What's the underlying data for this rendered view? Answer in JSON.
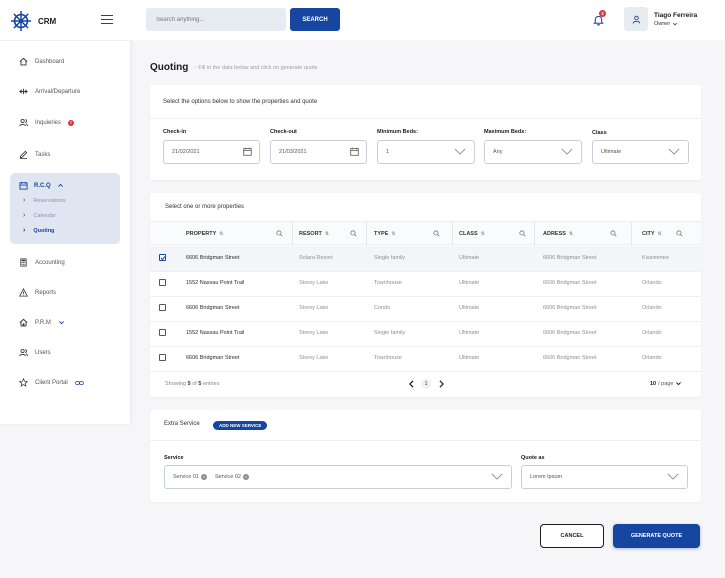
{
  "app": {
    "name": "CRM"
  },
  "colors": {
    "primary": "#1646a0",
    "alert": "#e2303a",
    "selected_bg": "#dfe6f1"
  },
  "sidebar": {
    "items": [
      {
        "label": "Dashboard",
        "icon": "home-icon"
      },
      {
        "label": "Arrival/Departure",
        "icon": "arrows-icon"
      },
      {
        "label": "Inquieries",
        "icon": "users-icon",
        "badge": "!"
      },
      {
        "label": "Tasks",
        "icon": "pencil-icon"
      },
      {
        "label": "R.C.Q",
        "icon": "calendar-icon"
      },
      {
        "label": "Accounting",
        "icon": "calculator-icon"
      },
      {
        "label": "Reports",
        "icon": "warning-icon"
      },
      {
        "label": "P.R.M",
        "icon": "home-icon"
      },
      {
        "label": "Users",
        "icon": "users-icon"
      },
      {
        "label": "Client Portal",
        "icon": "star-icon"
      }
    ],
    "rcq_sub": [
      "Reservations",
      "Calendar",
      "Quoting"
    ]
  },
  "header": {
    "search_placeholder": "Search anything...",
    "search_label": "SEARCH",
    "notifications": "2",
    "user_name": "Tiago Ferreira",
    "user_role": "Owner"
  },
  "page": {
    "title": "Quoting",
    "subtitle": "- Fill in the data below and click on generate quote"
  },
  "filters": {
    "title": "Select the options below to show the properties and quote",
    "checkin_label": "Check-in",
    "checkin_value": "21/02/2021",
    "checkout_label": "Check-out",
    "checkout_value": "21/03/2021",
    "minbeds_label": "Minimum Beds:",
    "minbeds_value": "1",
    "maxbeds_label": "Maximum Beds:",
    "maxbeds_value": "Any",
    "class_label": "Class",
    "class_value": "Ultimate"
  },
  "properties": {
    "title": "Select one or more properties",
    "headers": [
      "PROPERTY",
      "RESORT",
      "TYPE",
      "CLASS",
      "ADRESS",
      "CITY"
    ],
    "rows": [
      {
        "checked": true,
        "property": "6606 Bridgman Street",
        "resort": "Solara Resort",
        "type": "Single family",
        "class": "Ultimate",
        "address": "6606 Bridgman Street",
        "city": "Kissimmee"
      },
      {
        "checked": false,
        "property": "1552 Nassau Point Trail",
        "resort": "Storey Lake",
        "type": "Townhouse",
        "class": "Ultimate",
        "address": "6606 Bridgman Street",
        "city": "Orlando"
      },
      {
        "checked": false,
        "property": "6606 Bridgman Street",
        "resort": "Storey Lake",
        "type": "Condo",
        "class": "Ultimate",
        "address": "6606 Bridgman Street",
        "city": "Orlando"
      },
      {
        "checked": false,
        "property": "1552 Nassau Point Trail",
        "resort": "Storey Lake",
        "type": "Single family",
        "class": "Ultimate",
        "address": "6606 Bridgman Street",
        "city": "Orlando"
      },
      {
        "checked": false,
        "property": "6606 Bridgman Street",
        "resort": "Storey Lake",
        "type": "Townhouse",
        "class": "Ultimate",
        "address": "6606 Bridgman Street",
        "city": "Orlando"
      }
    ],
    "footer": {
      "showing_prefix": "Showing",
      "showing_from": "5",
      "showing_of": "of",
      "showing_total": "5",
      "showing_suffix": "entries",
      "page": "1",
      "per_page": "10",
      "per_page_suffix": "/ page"
    }
  },
  "extra": {
    "title": "Extra Service",
    "add_label": "ADD NEW SERVICE",
    "service_label": "Service",
    "services": [
      "Service 01",
      "Service 02"
    ],
    "quote_label": "Quote as",
    "quote_value": "Lorem Ipsum"
  },
  "actions": {
    "cancel": "CANCEL",
    "generate": "GENERATE QUOTE"
  }
}
